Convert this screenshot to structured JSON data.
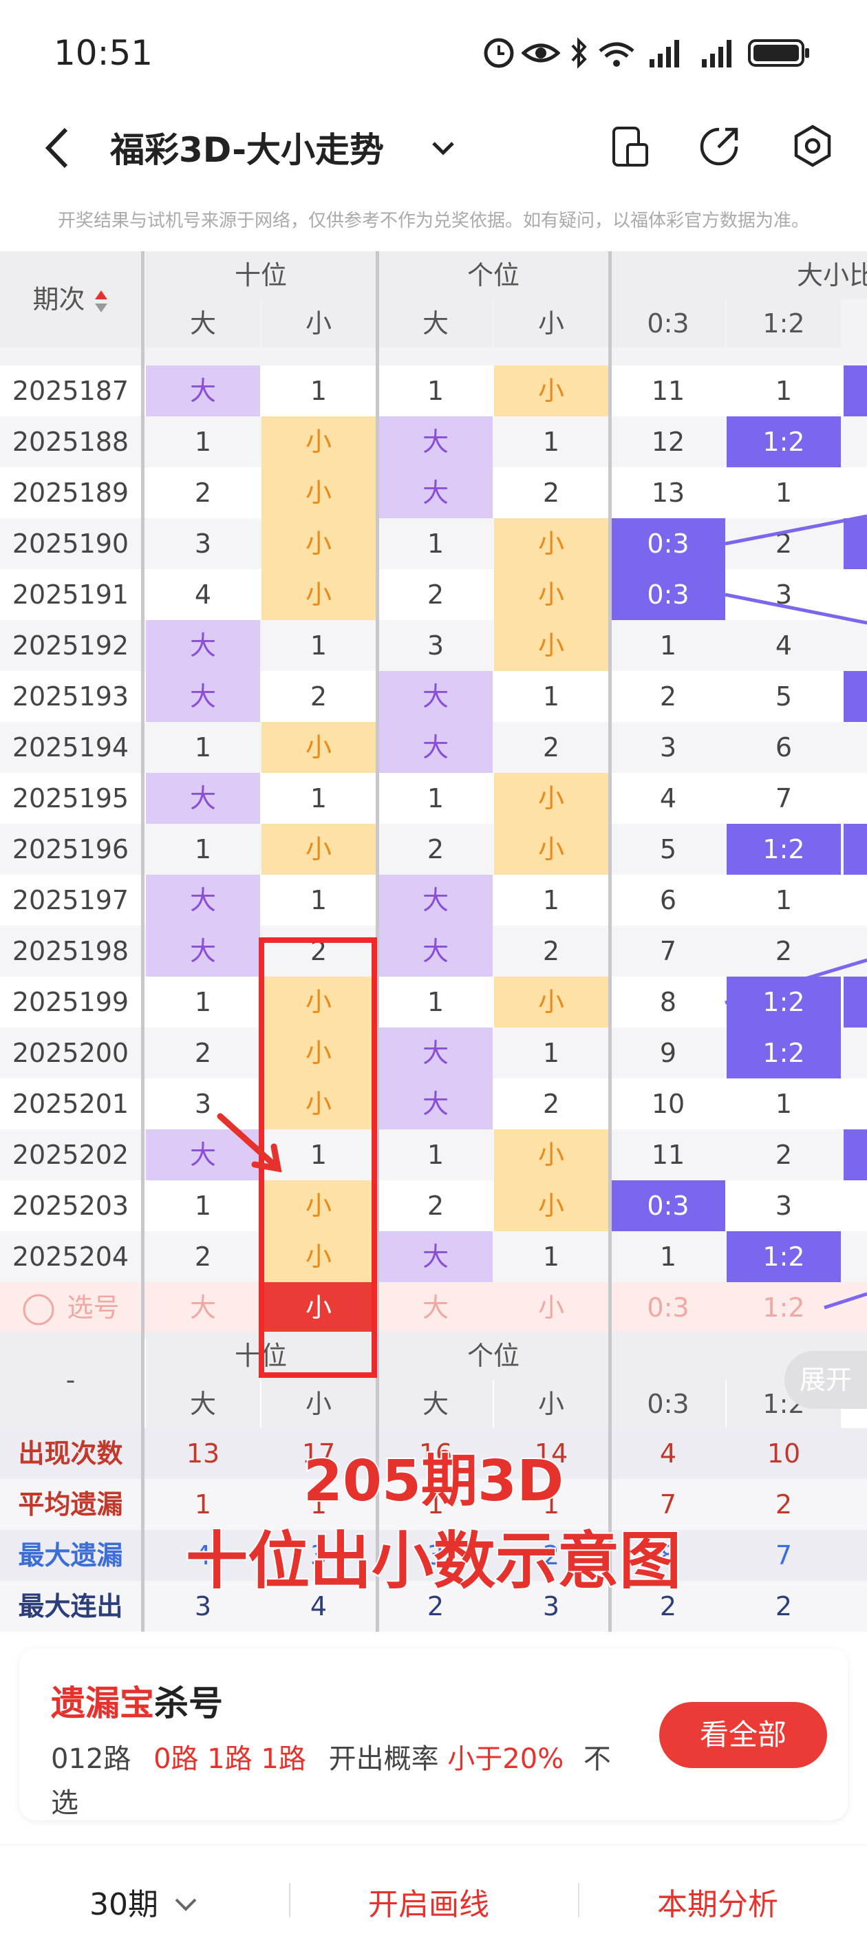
{
  "status": {
    "time": "10:51"
  },
  "nav": {
    "title": "福彩3D-大小走势"
  },
  "notice": "开奖结果与试机号来源于网络，仅供参考不作为兑奖依据。如有疑问，以福体彩官方数据为准。",
  "table": {
    "period_header": "期次",
    "groups": [
      "十位",
      "个位",
      "大小比"
    ],
    "subheaders": [
      "大",
      "小",
      "大",
      "小",
      "0:3",
      "1:2"
    ],
    "rows": [
      {
        "p": "2025187",
        "c": [
          [
            "大",
            "big"
          ],
          [
            "1",
            "n"
          ],
          [
            "1",
            "n"
          ],
          [
            "小",
            "small"
          ],
          [
            "11",
            "n"
          ],
          [
            "1",
            "n"
          ]
        ]
      },
      {
        "p": "2025188",
        "c": [
          [
            "1",
            "n"
          ],
          [
            "小",
            "small"
          ],
          [
            "大",
            "big"
          ],
          [
            "1",
            "n"
          ],
          [
            "12",
            "n"
          ],
          [
            "1:2",
            "blue"
          ]
        ]
      },
      {
        "p": "2025189",
        "c": [
          [
            "2",
            "n"
          ],
          [
            "小",
            "small"
          ],
          [
            "大",
            "big"
          ],
          [
            "2",
            "n"
          ],
          [
            "13",
            "n"
          ],
          [
            "1",
            "n"
          ]
        ]
      },
      {
        "p": "2025190",
        "c": [
          [
            "3",
            "n"
          ],
          [
            "小",
            "small"
          ],
          [
            "1",
            "n"
          ],
          [
            "小",
            "small"
          ],
          [
            "0:3",
            "blue"
          ],
          [
            "2",
            "n"
          ]
        ]
      },
      {
        "p": "2025191",
        "c": [
          [
            "4",
            "n"
          ],
          [
            "小",
            "small"
          ],
          [
            "2",
            "n"
          ],
          [
            "小",
            "small"
          ],
          [
            "0:3",
            "blue"
          ],
          [
            "3",
            "n"
          ]
        ]
      },
      {
        "p": "2025192",
        "c": [
          [
            "大",
            "big"
          ],
          [
            "1",
            "n"
          ],
          [
            "3",
            "n"
          ],
          [
            "小",
            "small"
          ],
          [
            "1",
            "n"
          ],
          [
            "4",
            "n"
          ]
        ]
      },
      {
        "p": "2025193",
        "c": [
          [
            "大",
            "big"
          ],
          [
            "2",
            "n"
          ],
          [
            "大",
            "big"
          ],
          [
            "1",
            "n"
          ],
          [
            "2",
            "n"
          ],
          [
            "5",
            "n"
          ]
        ]
      },
      {
        "p": "2025194",
        "c": [
          [
            "1",
            "n"
          ],
          [
            "小",
            "small"
          ],
          [
            "大",
            "big"
          ],
          [
            "2",
            "n"
          ],
          [
            "3",
            "n"
          ],
          [
            "6",
            "n"
          ]
        ]
      },
      {
        "p": "2025195",
        "c": [
          [
            "大",
            "big"
          ],
          [
            "1",
            "n"
          ],
          [
            "1",
            "n"
          ],
          [
            "小",
            "small"
          ],
          [
            "4",
            "n"
          ],
          [
            "7",
            "n"
          ]
        ]
      },
      {
        "p": "2025196",
        "c": [
          [
            "1",
            "n"
          ],
          [
            "小",
            "small"
          ],
          [
            "2",
            "n"
          ],
          [
            "小",
            "small"
          ],
          [
            "5",
            "n"
          ],
          [
            "1:2",
            "blue"
          ]
        ]
      },
      {
        "p": "2025197",
        "c": [
          [
            "大",
            "big"
          ],
          [
            "1",
            "n"
          ],
          [
            "大",
            "big"
          ],
          [
            "1",
            "n"
          ],
          [
            "6",
            "n"
          ],
          [
            "1",
            "n"
          ]
        ]
      },
      {
        "p": "2025198",
        "c": [
          [
            "大",
            "big"
          ],
          [
            "2",
            "n"
          ],
          [
            "大",
            "big"
          ],
          [
            "2",
            "n"
          ],
          [
            "7",
            "n"
          ],
          [
            "2",
            "n"
          ]
        ]
      },
      {
        "p": "2025199",
        "c": [
          [
            "1",
            "n"
          ],
          [
            "小",
            "small"
          ],
          [
            "1",
            "n"
          ],
          [
            "小",
            "small"
          ],
          [
            "8",
            "n"
          ],
          [
            "1:2",
            "blue"
          ]
        ]
      },
      {
        "p": "2025200",
        "c": [
          [
            "2",
            "n"
          ],
          [
            "小",
            "small"
          ],
          [
            "大",
            "big"
          ],
          [
            "1",
            "n"
          ],
          [
            "9",
            "n"
          ],
          [
            "1:2",
            "blue"
          ]
        ]
      },
      {
        "p": "2025201",
        "c": [
          [
            "3",
            "n"
          ],
          [
            "小",
            "small"
          ],
          [
            "大",
            "big"
          ],
          [
            "2",
            "n"
          ],
          [
            "10",
            "n"
          ],
          [
            "1",
            "n"
          ]
        ]
      },
      {
        "p": "2025202",
        "c": [
          [
            "大",
            "big"
          ],
          [
            "1",
            "n"
          ],
          [
            "1",
            "n"
          ],
          [
            "小",
            "small"
          ],
          [
            "11",
            "n"
          ],
          [
            "2",
            "n"
          ]
        ]
      },
      {
        "p": "2025203",
        "c": [
          [
            "1",
            "n"
          ],
          [
            "小",
            "small"
          ],
          [
            "2",
            "n"
          ],
          [
            "小",
            "small"
          ],
          [
            "0:3",
            "blue"
          ],
          [
            "3",
            "n"
          ]
        ]
      },
      {
        "p": "2025204",
        "c": [
          [
            "2",
            "n"
          ],
          [
            "小",
            "small"
          ],
          [
            "大",
            "big"
          ],
          [
            "1",
            "n"
          ],
          [
            "1",
            "n"
          ],
          [
            "1:2",
            "blue"
          ]
        ]
      }
    ],
    "select_row": {
      "label": "选号",
      "cells": [
        "大",
        "小",
        "大",
        "小",
        "0:3",
        "1:2"
      ]
    }
  },
  "stats": {
    "groups": [
      "十位",
      "个位"
    ],
    "subheaders": [
      "大",
      "小",
      "大",
      "小",
      "0:3",
      "1:2"
    ],
    "dash": "-",
    "expand_label": "展开",
    "rows": [
      {
        "label": "出现次数",
        "color": "#c0392b",
        "values": [
          "13",
          "17",
          "16",
          "14",
          "4",
          "10"
        ]
      },
      {
        "label": "平均遗漏",
        "color": "#c0392b",
        "values": [
          "1",
          "1",
          "1",
          "1",
          "7",
          "2"
        ]
      },
      {
        "label": "最大遗漏",
        "color": "#3b6fd6",
        "values": [
          "4",
          "3",
          "3",
          "2",
          "8",
          "7"
        ]
      },
      {
        "label": "最大连出",
        "color": "#2c3e7a",
        "values": [
          "3",
          "4",
          "2",
          "3",
          "2",
          "2"
        ]
      }
    ]
  },
  "overlay": {
    "line1": "205期3D",
    "line2": "十位出小数示意图"
  },
  "card": {
    "title_red": "遗漏宝",
    "title_black": "杀号",
    "route_label": "012路",
    "routes": "0路 1路 1路",
    "prob_label": "开出概率",
    "prob_value": "小于20%",
    "suffix1": "不",
    "suffix2": "选",
    "button": "看全部"
  },
  "bottom": {
    "periods": "30期",
    "draw": "开启画线",
    "analysis": "本期分析"
  }
}
